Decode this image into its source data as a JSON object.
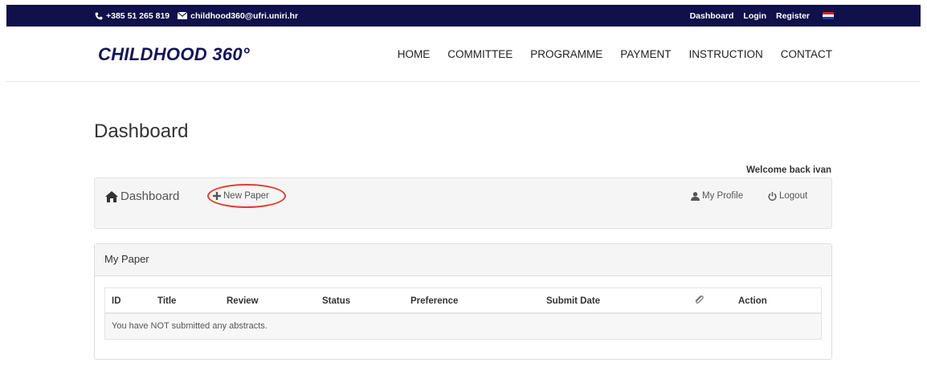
{
  "topbar": {
    "phone": "+385 51 265 819",
    "email": "childhood360@ufri.uniri.hr",
    "links": [
      "Dashboard",
      "Login",
      "Register"
    ],
    "language_icon": "croatian-flag-icon"
  },
  "header": {
    "logo": "CHILDHOOD 360°",
    "nav": [
      "HOME",
      "COMMITTEE",
      "PROGRAMME",
      "PAYMENT",
      "INSTRUCTION",
      "CONTACT"
    ]
  },
  "page": {
    "title": "Dashboard",
    "welcome": "Welcome back ivan"
  },
  "dashbar": {
    "home_label": "Dashboard",
    "new_paper_label": "New Paper",
    "profile_label": "My Profile",
    "logout_label": "Logout"
  },
  "panel": {
    "title": "My Paper",
    "columns": [
      "ID",
      "Title",
      "Review",
      "Status",
      "Preference",
      "Submit Date",
      "Action"
    ],
    "attachment_icon": "paperclip-icon",
    "empty_message": "You have NOT submitted any abstracts."
  },
  "colors": {
    "topbar": "#10104a",
    "logo": "#141456",
    "highlight": "#e13b2d"
  }
}
